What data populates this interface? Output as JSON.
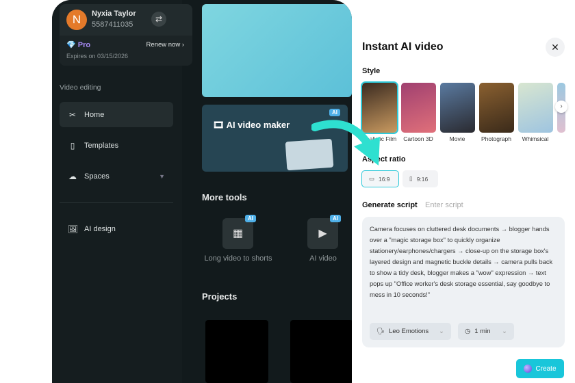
{
  "user": {
    "initial": "N",
    "name": "Nyxia Taylor",
    "id": "5587411035",
    "plan": "Pro",
    "renew": "Renew now",
    "expires": "Expires on 03/15/2026"
  },
  "sidebar": {
    "section": "Video editing",
    "items": [
      {
        "label": "Home"
      },
      {
        "label": "Templates"
      },
      {
        "label": "Spaces"
      },
      {
        "label": "AI design"
      }
    ]
  },
  "main": {
    "ai_video_maker": "AI video maker",
    "ai_badge": "AI",
    "more_tools": "More tools",
    "tools": [
      {
        "label": "Long video to shorts"
      },
      {
        "label": "AI video"
      }
    ],
    "projects": "Projects"
  },
  "panel": {
    "title": "Instant AI video",
    "style_label": "Style",
    "styles": [
      {
        "label": "Realistic Film",
        "colors": [
          "#3a2a20",
          "#c99a60"
        ]
      },
      {
        "label": "Cartoon 3D",
        "colors": [
          "#a04070",
          "#e0707a"
        ]
      },
      {
        "label": "Movie",
        "colors": [
          "#5a7aa0",
          "#2a2a30"
        ]
      },
      {
        "label": "Photograph",
        "colors": [
          "#8a6030",
          "#3a2a1a"
        ]
      },
      {
        "label": "Whimsical",
        "colors": [
          "#d8e6d0",
          "#9ec4e0"
        ]
      }
    ],
    "aspect_label": "Aspect ratio",
    "ratios": [
      "16:9",
      "9:16"
    ],
    "script_label": "Generate script",
    "script_alt": "Enter script",
    "script_text": "Camera focuses on cluttered desk documents → blogger hands over a \"magic storage box\" to quickly organize stationery/earphones/chargers → close-up on the storage box's layered design and magnetic buckle details → camera pulls back to show a tidy desk, blogger makes a \"wow\" expression → text pops up \"Office worker's desk storage essential, say goodbye to mess in 10 seconds!\"",
    "voice": "Leo Emotions",
    "duration": "1 min",
    "create": "Create"
  },
  "colors": {
    "accent": "#19c6da"
  }
}
